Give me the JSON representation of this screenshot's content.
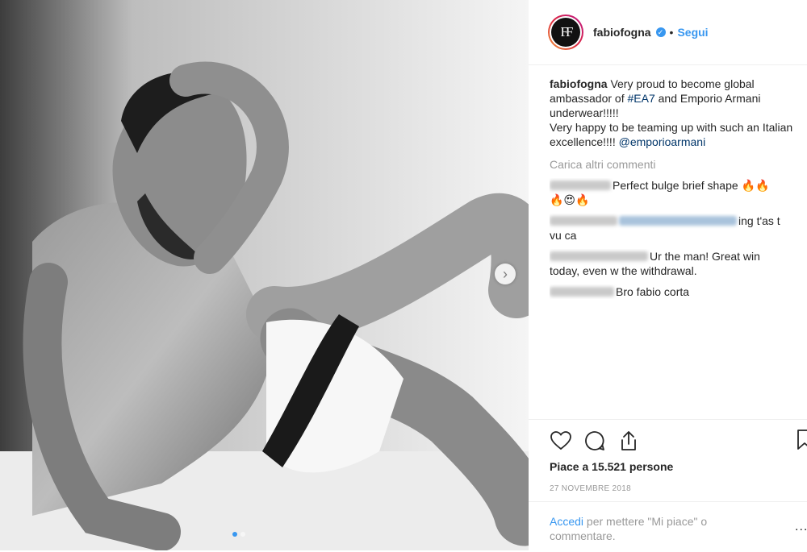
{
  "post": {
    "username": "fabiofogna",
    "avatar_text": "FF",
    "verified_icon": "verified-badge-icon",
    "separator": "•",
    "follow_label": "Segui",
    "caption": {
      "part1": "Very proud to become global ambassador of ",
      "hashtag": "#EA7",
      "part2": " and Emporio Armani underwear!!!!!",
      "part3": "Very happy to be teaming up with such an Italian excellence!!!! ",
      "mention": "@emporioarmani"
    },
    "load_more_label": "Carica altri commenti",
    "comments": [
      {
        "text": "Perfect bulge brief shape 🔥🔥",
        "text_line2": "🔥😍🔥"
      },
      {
        "text": "ing t'as t",
        "text_line2": "vu ca"
      },
      {
        "text": "Ur the man! Great win",
        "text_line2": "today, even w the withdrawal."
      },
      {
        "text": "Bro fabio corta"
      }
    ],
    "likes_label": "Piace a 15.521 persone",
    "date": "27 NOVEMBRE 2018",
    "login_link": "Accedi",
    "login_text": " per mettere \"Mi piace\" o commentare.",
    "more_label": "..."
  },
  "carousel": {
    "next_icon": "chevron-right-icon",
    "next_glyph": "›",
    "total_slides": 2,
    "active_slide": 1,
    "accent_color": "#3897f0"
  },
  "icons": [
    "heart-icon",
    "comment-icon",
    "share-icon",
    "bookmark-icon"
  ]
}
